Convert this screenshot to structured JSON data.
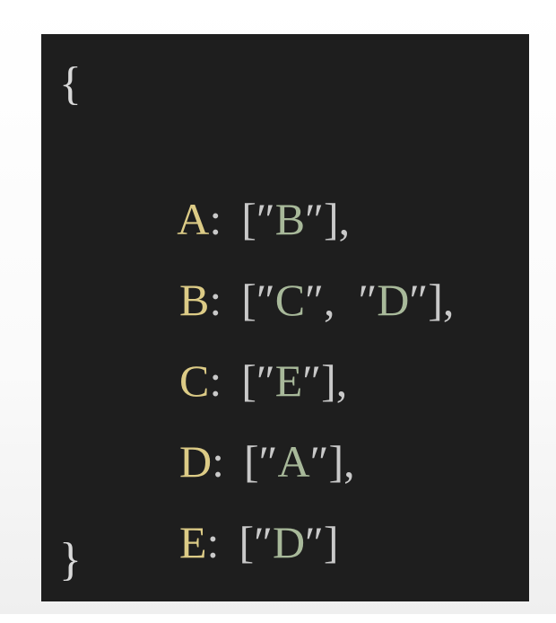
{
  "code": {
    "open_brace": "{",
    "close_brace": "}",
    "entries": [
      {
        "key": "A",
        "values": [
          "B"
        ],
        "trailing": ","
      },
      {
        "key": "B",
        "values": [
          "C",
          "D"
        ],
        "trailing": ","
      },
      {
        "key": "C",
        "values": [
          "E"
        ],
        "trailing": ","
      },
      {
        "key": "D",
        "values": [
          "A"
        ],
        "trailing": ","
      },
      {
        "key": "E",
        "values": [
          "D"
        ],
        "trailing": ""
      }
    ]
  },
  "colors": {
    "panel_background": "#1e1e1e",
    "key_color": "#dccb86",
    "value_color": "#a8b99a",
    "punctuation_color": "#c9c9c9"
  }
}
